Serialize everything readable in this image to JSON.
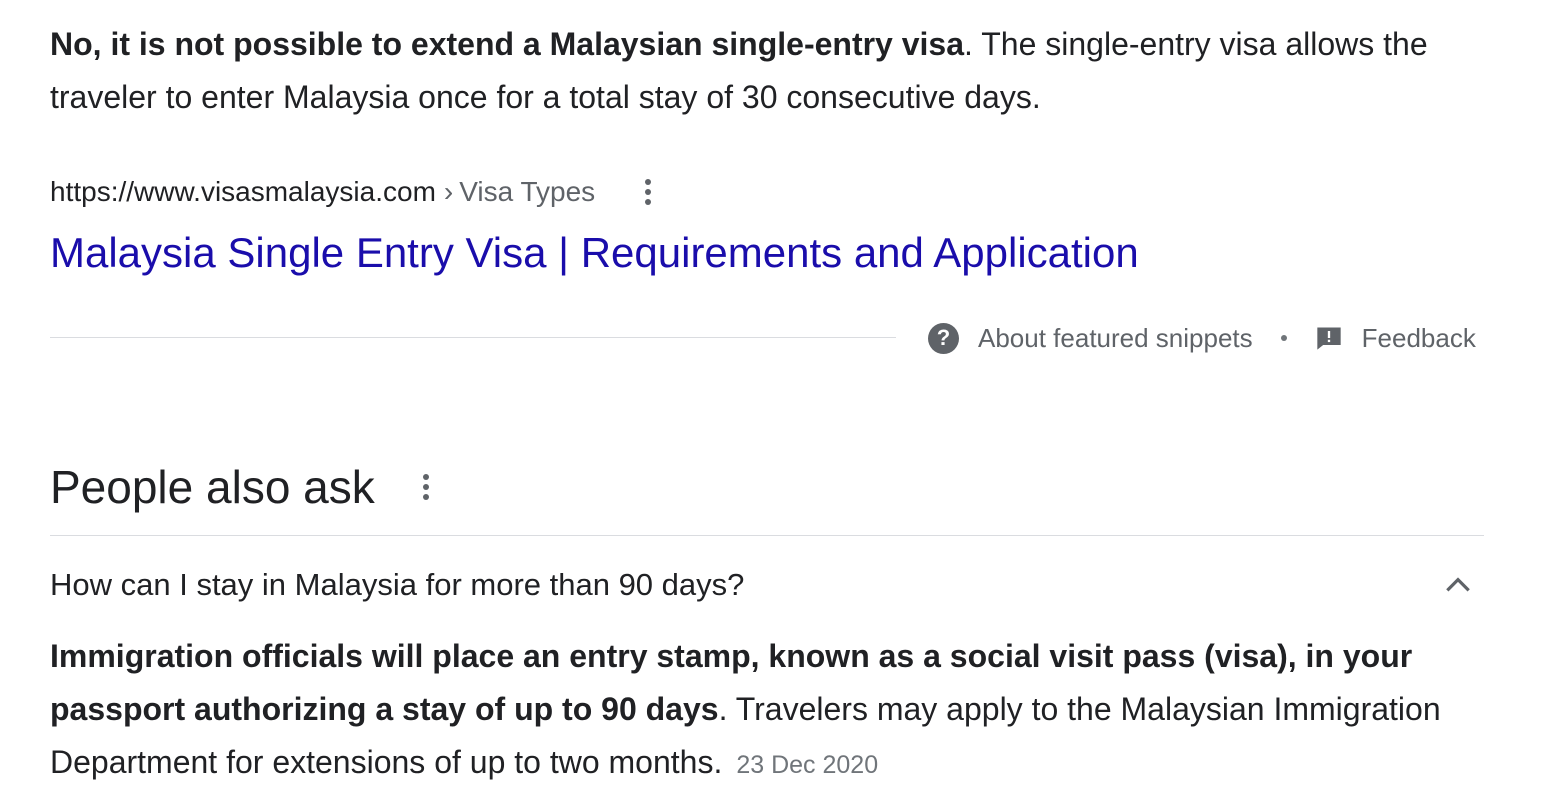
{
  "featured_snippet": {
    "answer_bold": "No, it is not possible to extend a Malaysian single-entry visa",
    "answer_rest": ". The single-entry visa allows the traveler to enter Malaysia once for a total stay of 30 consecutive days.",
    "source_url": "https://www.visasmalaysia.com",
    "breadcrumb_separator": "›",
    "breadcrumb": "Visa Types",
    "result_title": "Malaysia Single Entry Visa | Requirements and Application",
    "about_label": "About featured snippets",
    "footer_separator": "•",
    "feedback_label": "Feedback"
  },
  "people_also_ask": {
    "heading": "People also ask",
    "questions": [
      {
        "question": "How can I stay in Malaysia for more than 90 days?",
        "answer_bold": "Immigration officials will place an entry stamp, known as a social visit pass (visa), in your passport authorizing a stay of up to 90 days",
        "answer_rest": ". Travelers may apply to the Malaysian Immigration Department for extensions of up to two months.",
        "date": "23 Dec 2020",
        "expanded": true
      }
    ]
  },
  "icons": {
    "more_options": "more-vert-icon",
    "help": "help-circle-icon",
    "feedback": "feedback-icon",
    "collapse": "chevron-up-icon"
  },
  "colors": {
    "link": "#1a0dab",
    "text": "#202124",
    "secondary": "#5f6368",
    "divider": "#dadce0"
  }
}
